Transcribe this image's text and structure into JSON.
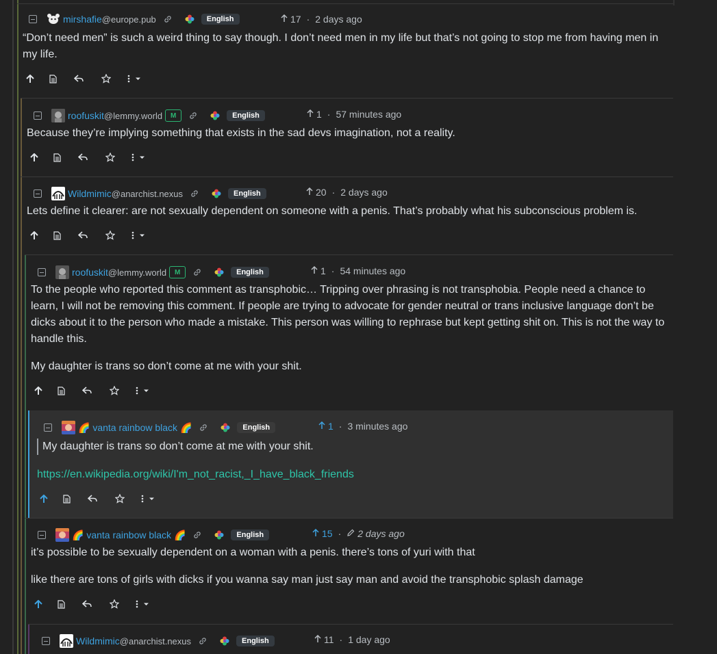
{
  "lang_label": "English",
  "colors": {
    "accent": "#3ea2e0",
    "bg": "#222222",
    "panel": "#303030",
    "link": "#2ec5a9",
    "mod": "#2bb673"
  },
  "comments": [
    {
      "user": "mirshafie",
      "instance": "@europe.pub",
      "score": "17",
      "time": "2 days ago",
      "body": [
        "“Don’t need men” is such a weird thing to say though. I don’t need men in my life but that’s not going to stop me from having men in my life."
      ]
    },
    {
      "user": "roofuskit",
      "instance": "@lemmy.world",
      "mod_badge": "M",
      "score": "1",
      "time": "57 minutes ago",
      "body": [
        "Because they’re implying something that exists in the sad devs imagination, not a reality."
      ]
    },
    {
      "user": "Wildmimic",
      "instance": "@anarchist.nexus",
      "score": "20",
      "time": "2 days ago",
      "body": [
        "Lets define it clearer: are not sexually dependent on someone with a penis. That’s probably what his subconscious problem is."
      ]
    },
    {
      "user": "roofuskit",
      "instance": "@lemmy.world",
      "mod_badge": "M",
      "score": "1",
      "time": "54 minutes ago",
      "body": [
        "To the people who reported this comment as transphobic… Tripping over phrasing is not transphobia. People need a chance to learn, I will not be removing this comment. If people are trying to advocate for gender neutral or trans inclusive language don’t be dicks about it to the person who made a mistake. This person was willing to rephrase but kept getting shit on. This is not the way to handle this.",
        "My daughter is trans so don’t come at me with your shit."
      ]
    },
    {
      "user": "🌈 vanta rainbow black 🌈",
      "score": "1",
      "time": "3 minutes ago",
      "quote": "My daughter is trans so don’t come at me with your shit.",
      "link": "https://en.wikipedia.org/wiki/I'm_not_racist,_I_have_black_friends"
    },
    {
      "user": "🌈 vanta rainbow black 🌈",
      "score": "15",
      "time": "2 days ago",
      "body": [
        "it’s possible to be sexually dependent on a woman with a penis. there’s tons of yuri with that",
        "like there are tons of girls with dicks if you wanna say man just say man and avoid the transphobic splash damage"
      ]
    },
    {
      "user": "Wildmimic",
      "instance": "@anarchist.nexus",
      "score": "11",
      "time": "1 day ago"
    }
  ]
}
